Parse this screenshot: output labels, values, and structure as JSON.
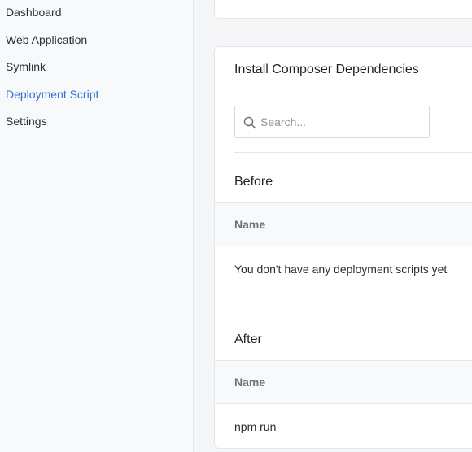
{
  "sidebar": {
    "items": [
      {
        "label": "Dashboard",
        "active": false
      },
      {
        "label": "Web Application",
        "active": false
      },
      {
        "label": "Symlink",
        "active": false
      },
      {
        "label": "Deployment Script",
        "active": true
      },
      {
        "label": "Settings",
        "active": false
      }
    ]
  },
  "card": {
    "title": "Install Composer Dependencies",
    "search": {
      "placeholder": "Search...",
      "value": "",
      "icon": "search-icon"
    },
    "before": {
      "title": "Before",
      "column_header": "Name",
      "empty_message": "You don't have any deployment scripts yet"
    },
    "after": {
      "title": "After",
      "column_header": "Name",
      "rows": [
        "npm run"
      ]
    }
  },
  "colors": {
    "accent": "#2f6fd2",
    "sidebar_bg": "#f8f9fa",
    "page_bg": "#f5f6f8",
    "border": "#e4e6ea"
  }
}
